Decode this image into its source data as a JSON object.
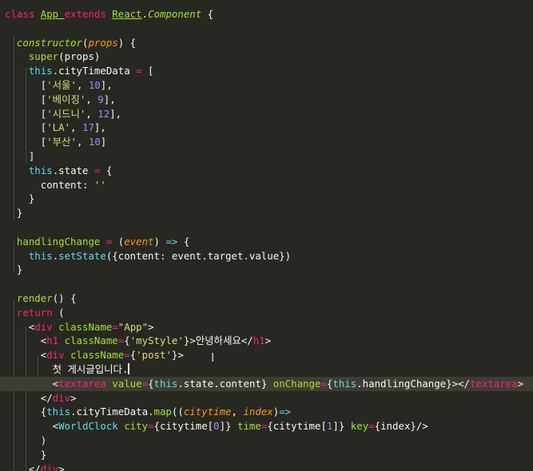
{
  "theme": {
    "background": "#272822",
    "highlight": "#3e3d32",
    "keyword": "#f92672",
    "class_name": "#a6e22e",
    "storage": "#66d9ef",
    "string": "#e6db74",
    "number": "#ae81ff",
    "text": "#f8f8f2",
    "parameter": "#fd971f"
  },
  "editor": {
    "highlighted_line": 26,
    "mouse_pointer_icon": "text-cursor-ibeam",
    "lines": [
      [
        {
          "t": "class ",
          "c": "kw"
        },
        {
          "t": "App ",
          "c": "cls"
        },
        {
          "t": "extends ",
          "c": "kw"
        },
        {
          "t": "React",
          "c": "cls"
        },
        {
          "t": ".",
          "c": "tx"
        },
        {
          "t": "Component",
          "c": "clsi"
        },
        {
          "t": " {",
          "c": "tx"
        }
      ],
      [],
      [
        {
          "t": "  ",
          "c": "tx"
        },
        {
          "t": "constructor",
          "c": "fni"
        },
        {
          "t": "(",
          "c": "tx"
        },
        {
          "t": "props",
          "c": "param"
        },
        {
          "t": ") {",
          "c": "tx"
        }
      ],
      [
        {
          "t": "    ",
          "c": "tx"
        },
        {
          "t": "super",
          "c": "fn"
        },
        {
          "t": "(props)",
          "c": "tx"
        }
      ],
      [
        {
          "t": "    ",
          "c": "tx"
        },
        {
          "t": "this",
          "c": "sto"
        },
        {
          "t": ".cityTimeData ",
          "c": "tx"
        },
        {
          "t": "=",
          "c": "kw"
        },
        {
          "t": " [",
          "c": "tx"
        }
      ],
      [
        {
          "t": "      [",
          "c": "tx"
        },
        {
          "t": "'서울'",
          "c": "str"
        },
        {
          "t": ", ",
          "c": "tx"
        },
        {
          "t": "10",
          "c": "num"
        },
        {
          "t": "],",
          "c": "tx"
        }
      ],
      [
        {
          "t": "      [",
          "c": "tx"
        },
        {
          "t": "'베이징'",
          "c": "str"
        },
        {
          "t": ", ",
          "c": "tx"
        },
        {
          "t": "9",
          "c": "num"
        },
        {
          "t": "],",
          "c": "tx"
        }
      ],
      [
        {
          "t": "      [",
          "c": "tx"
        },
        {
          "t": "'시드니'",
          "c": "str"
        },
        {
          "t": ", ",
          "c": "tx"
        },
        {
          "t": "12",
          "c": "num"
        },
        {
          "t": "],",
          "c": "tx"
        }
      ],
      [
        {
          "t": "      [",
          "c": "tx"
        },
        {
          "t": "'LA'",
          "c": "str"
        },
        {
          "t": ", ",
          "c": "tx"
        },
        {
          "t": "17",
          "c": "num"
        },
        {
          "t": "],",
          "c": "tx"
        }
      ],
      [
        {
          "t": "      [",
          "c": "tx"
        },
        {
          "t": "'부산'",
          "c": "str"
        },
        {
          "t": ", ",
          "c": "tx"
        },
        {
          "t": "10",
          "c": "num"
        },
        {
          "t": "]",
          "c": "tx"
        }
      ],
      [
        {
          "t": "    ]",
          "c": "tx"
        }
      ],
      [
        {
          "t": "    ",
          "c": "tx"
        },
        {
          "t": "this",
          "c": "sto"
        },
        {
          "t": ".state ",
          "c": "tx"
        },
        {
          "t": "=",
          "c": "kw"
        },
        {
          "t": " {",
          "c": "tx"
        }
      ],
      [
        {
          "t": "      content: ",
          "c": "tx"
        },
        {
          "t": "''",
          "c": "str"
        }
      ],
      [
        {
          "t": "    }",
          "c": "tx"
        }
      ],
      [
        {
          "t": "  }",
          "c": "tx"
        }
      ],
      [],
      [
        {
          "t": "  ",
          "c": "tx"
        },
        {
          "t": "handlingChange",
          "c": "fn"
        },
        {
          "t": " ",
          "c": "tx"
        },
        {
          "t": "=",
          "c": "kw"
        },
        {
          "t": " (",
          "c": "tx"
        },
        {
          "t": "event",
          "c": "param"
        },
        {
          "t": ") ",
          "c": "tx"
        },
        {
          "t": "=>",
          "c": "sto"
        },
        {
          "t": " {",
          "c": "tx"
        }
      ],
      [
        {
          "t": "    ",
          "c": "tx"
        },
        {
          "t": "this",
          "c": "sto"
        },
        {
          "t": ".",
          "c": "tx"
        },
        {
          "t": "setState",
          "c": "sto"
        },
        {
          "t": "({content: event.target.value})",
          "c": "tx"
        }
      ],
      [
        {
          "t": "  }",
          "c": "tx"
        }
      ],
      [],
      [
        {
          "t": "  ",
          "c": "tx"
        },
        {
          "t": "render",
          "c": "fn"
        },
        {
          "t": "() {",
          "c": "tx"
        }
      ],
      [
        {
          "t": "  ",
          "c": "tx"
        },
        {
          "t": "return",
          "c": "kw"
        },
        {
          "t": " (",
          "c": "tx"
        }
      ],
      [
        {
          "t": "    <",
          "c": "tx"
        },
        {
          "t": "div",
          "c": "kw"
        },
        {
          "t": " ",
          "c": "tx"
        },
        {
          "t": "className",
          "c": "fn"
        },
        {
          "t": "=",
          "c": "kw"
        },
        {
          "t": "\"App\"",
          "c": "str"
        },
        {
          "t": ">",
          "c": "tx"
        }
      ],
      [
        {
          "t": "      <",
          "c": "tx"
        },
        {
          "t": "h1",
          "c": "kw"
        },
        {
          "t": " ",
          "c": "tx"
        },
        {
          "t": "className",
          "c": "fn"
        },
        {
          "t": "=",
          "c": "kw"
        },
        {
          "t": "{",
          "c": "tx"
        },
        {
          "t": "'myStyle'",
          "c": "str"
        },
        {
          "t": "}",
          "c": "tx"
        },
        {
          "t": ">안녕하세요</",
          "c": "tx"
        },
        {
          "t": "h1",
          "c": "kw"
        },
        {
          "t": ">",
          "c": "tx"
        }
      ],
      [
        {
          "t": "      <",
          "c": "tx"
        },
        {
          "t": "div",
          "c": "kw"
        },
        {
          "t": " ",
          "c": "tx"
        },
        {
          "t": "className",
          "c": "fn"
        },
        {
          "t": "=",
          "c": "kw"
        },
        {
          "t": "{",
          "c": "tx"
        },
        {
          "t": "'post'",
          "c": "str"
        },
        {
          "t": "}>",
          "c": "tx"
        }
      ],
      [
        {
          "t": "        첫 게시글입니다.",
          "c": "tx"
        },
        {
          "t": "",
          "c": "cursor"
        }
      ],
      [
        {
          "t": "        <",
          "c": "tx"
        },
        {
          "t": "textarea",
          "c": "kw"
        },
        {
          "t": " ",
          "c": "tx"
        },
        {
          "t": "value",
          "c": "fn"
        },
        {
          "t": "=",
          "c": "kw"
        },
        {
          "t": "{",
          "c": "tx"
        },
        {
          "t": "this",
          "c": "sto"
        },
        {
          "t": ".state.content} ",
          "c": "tx"
        },
        {
          "t": "onChange",
          "c": "fn"
        },
        {
          "t": "=",
          "c": "kw"
        },
        {
          "t": "{",
          "c": "tx"
        },
        {
          "t": "this",
          "c": "sto"
        },
        {
          "t": ".handlingChange}></",
          "c": "tx"
        },
        {
          "t": "textarea",
          "c": "kw"
        },
        {
          "t": ">",
          "c": "tx"
        }
      ],
      [
        {
          "t": "      </",
          "c": "tx"
        },
        {
          "t": "div",
          "c": "kw"
        },
        {
          "t": ">",
          "c": "tx"
        }
      ],
      [
        {
          "t": "      {",
          "c": "tx"
        },
        {
          "t": "this",
          "c": "sto"
        },
        {
          "t": ".cityTimeData.",
          "c": "tx"
        },
        {
          "t": "map",
          "c": "fn"
        },
        {
          "t": "((",
          "c": "tx"
        },
        {
          "t": "citytime",
          "c": "param"
        },
        {
          "t": ", ",
          "c": "tx"
        },
        {
          "t": "index",
          "c": "param"
        },
        {
          "t": ")",
          "c": "tx"
        },
        {
          "t": "=>",
          "c": "sto"
        }
      ],
      [
        {
          "t": "        <",
          "c": "tx"
        },
        {
          "t": "WorldClock",
          "c": "sto"
        },
        {
          "t": " ",
          "c": "tx"
        },
        {
          "t": "city",
          "c": "fn"
        },
        {
          "t": "=",
          "c": "kw"
        },
        {
          "t": "{citytime[",
          "c": "tx"
        },
        {
          "t": "0",
          "c": "num"
        },
        {
          "t": "]} ",
          "c": "tx"
        },
        {
          "t": "time",
          "c": "fn"
        },
        {
          "t": "=",
          "c": "kw"
        },
        {
          "t": "{citytime[",
          "c": "tx"
        },
        {
          "t": "1",
          "c": "num"
        },
        {
          "t": "]} ",
          "c": "tx"
        },
        {
          "t": "key",
          "c": "fn"
        },
        {
          "t": "=",
          "c": "kw"
        },
        {
          "t": "{index}/>",
          "c": "tx"
        }
      ],
      [
        {
          "t": "      )",
          "c": "tx"
        }
      ],
      [
        {
          "t": "      }",
          "c": "tx"
        }
      ],
      [
        {
          "t": "    </",
          "c": "tx"
        },
        {
          "t": "div",
          "c": "kw"
        },
        {
          "t": ">",
          "c": "tx"
        }
      ]
    ]
  }
}
